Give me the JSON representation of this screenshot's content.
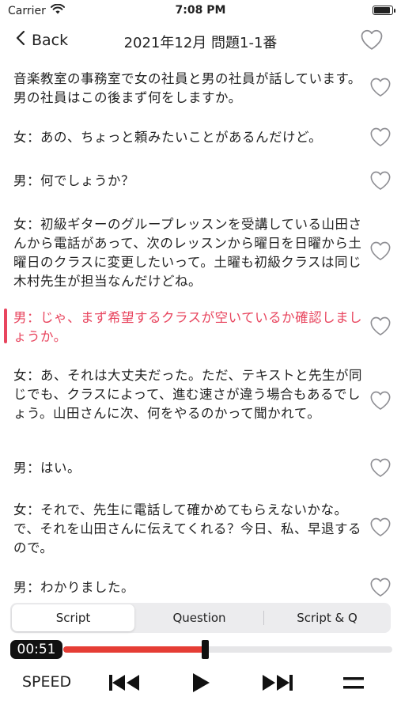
{
  "status_bar": {
    "carrier": "Carrier",
    "time": "7:08 PM",
    "battery_level": 1.0
  },
  "nav": {
    "back_label": "Back",
    "title": "2021年12月 問題1-1番"
  },
  "script_lines": [
    {
      "text": "音楽教室の事務室で女の社員と男の社員が話しています。男の社員はこの後まず何をしますか。",
      "active": false
    },
    {
      "text": "女：あの、ちょっと頼みたいことがあるんだけど。",
      "active": false
    },
    {
      "text": "男：何でしょうか？",
      "active": false
    },
    {
      "text": "女：初級ギターのグループレッスンを受講している山田さんから電話があって、次のレッスンから曜日を日曜から土曜日のクラスに変更したいって。土曜も初級クラスは同じ木村先生が担当なんだけどね。",
      "active": false
    },
    {
      "text": "男：じゃ、まず希望するクラスが空いているか確認しましょうか。",
      "active": true
    },
    {
      "text": "女：あ、それは大丈夫だった。ただ、テキストと先生が同じでも、クラスによって、進む速さが違う場合もあるでしょう。山田さんに次、何をやるのかって聞かれて。",
      "active": false
    },
    {
      "text": "男：はい。",
      "active": false
    },
    {
      "text": "女：それで、先生に電話して確かめてもらえないかな。で、それを山田さんに伝えてくれる？今日、私、早退するので。",
      "active": false
    },
    {
      "text": "男：わかりました。",
      "active": false
    }
  ],
  "tabs": {
    "script": "Script",
    "question": "Question",
    "script_q": "Script & Q",
    "selected": "Script"
  },
  "player": {
    "elapsed": "00:51",
    "progress_fraction": 0.43
  },
  "controls": {
    "speed_label": "SPEED"
  },
  "colors": {
    "accent": "#e8455e",
    "progress": "#e53d35"
  },
  "icons": {
    "back": "chevron-left-icon",
    "favorite": "heart-outline-icon",
    "previous": "skip-back-icon",
    "play": "play-icon",
    "next": "skip-forward-icon",
    "menu": "menu-icon",
    "wifi": "wifi-icon"
  }
}
